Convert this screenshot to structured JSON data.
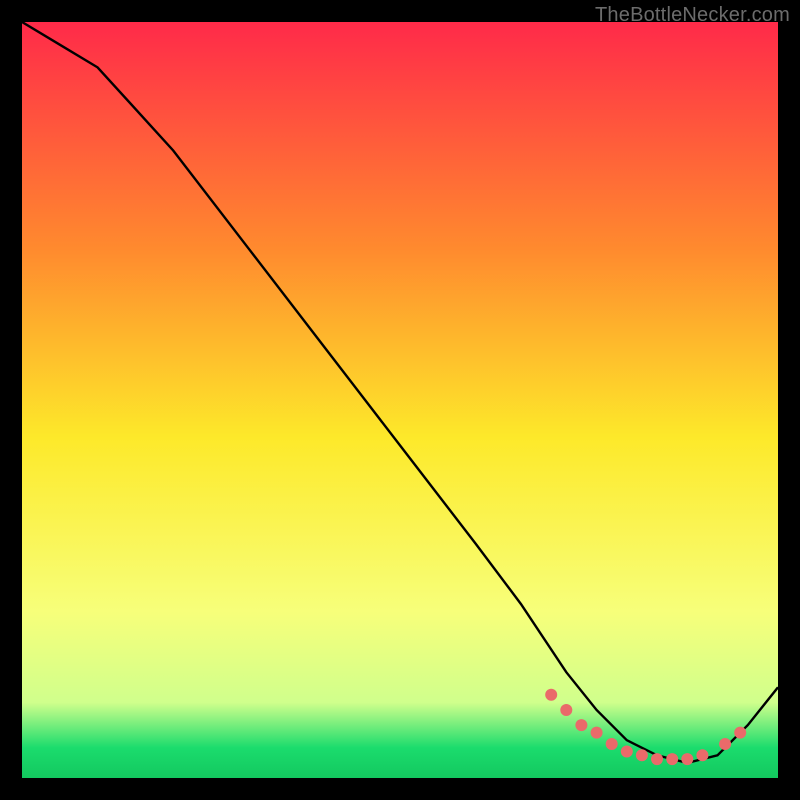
{
  "watermark": "TheBottleNecker.com",
  "colors": {
    "frame": "#000000",
    "curve": "#000000",
    "marker": "#ea6a6a",
    "gradient_top": "#ff2a49",
    "gradient_mid_upper": "#ff8a2e",
    "gradient_mid": "#fde92a",
    "gradient_mid_lower": "#f7ff7a",
    "gradient_low": "#d0ff8c",
    "gradient_green_strip": "#1bdc6d",
    "gradient_bottom": "#13c85f"
  },
  "chart_data": {
    "type": "line",
    "title": "",
    "xlabel": "",
    "ylabel": "",
    "xlim": [
      0,
      100
    ],
    "ylim": [
      0,
      100
    ],
    "series": [
      {
        "name": "bottleneck-curve",
        "x": [
          0,
          5,
          10,
          20,
          30,
          40,
          50,
          60,
          66,
          72,
          76,
          80,
          84,
          88,
          92,
          96,
          100
        ],
        "y": [
          100,
          97,
          94,
          83,
          70,
          57,
          44,
          31,
          23,
          14,
          9,
          5,
          3,
          2,
          3,
          7,
          12
        ]
      }
    ],
    "markers": {
      "name": "optimal-range-points",
      "x": [
        70,
        72,
        74,
        76,
        78,
        80,
        82,
        84,
        86,
        88,
        90,
        93,
        95
      ],
      "y": [
        11,
        9,
        7,
        6,
        4.5,
        3.5,
        3,
        2.5,
        2.5,
        2.5,
        3,
        4.5,
        6
      ]
    }
  }
}
